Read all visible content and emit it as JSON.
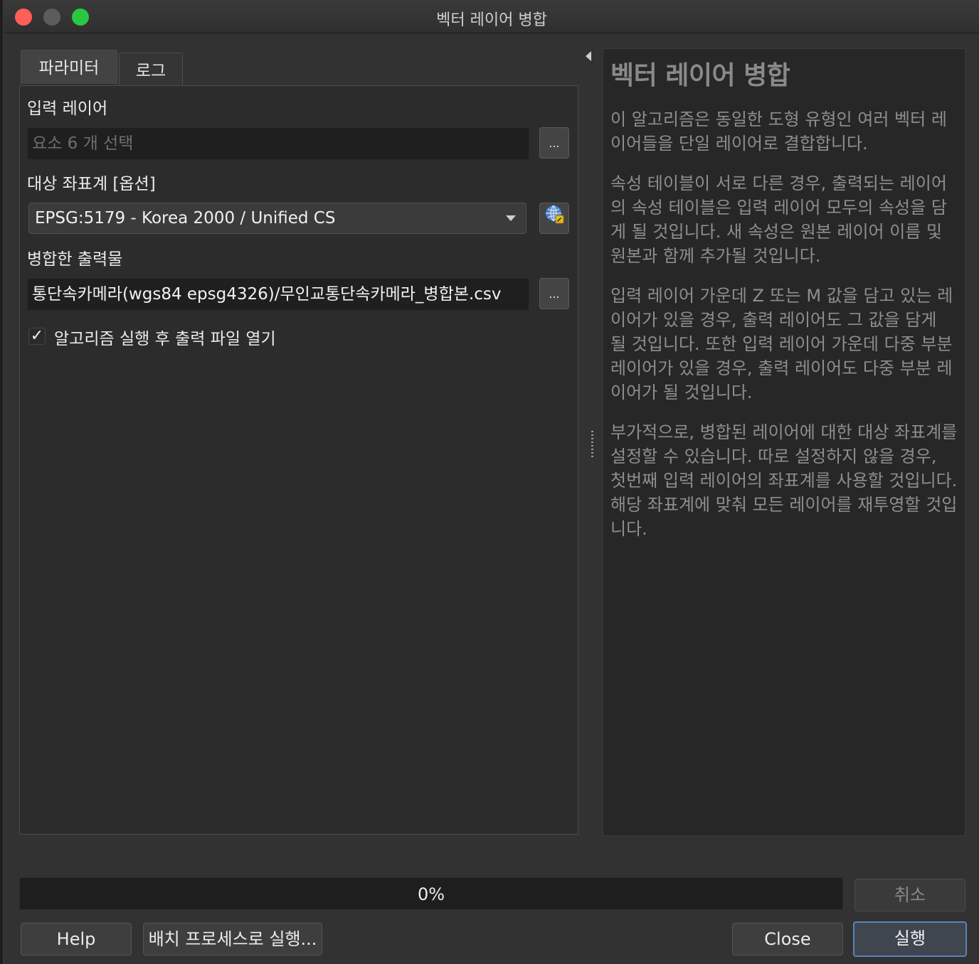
{
  "window": {
    "title": "벡터 레이어 병합"
  },
  "tabs": [
    {
      "label": "파라미터"
    },
    {
      "label": "로그"
    }
  ],
  "params": {
    "input_layer_label": "입력 레이어",
    "input_layer_value": "요소 6 개 선택",
    "browse_label": "...",
    "crs_label": "대상 좌표계 [옵션]",
    "crs_value": "EPSG:5179 - Korea 2000 / Unified CS",
    "output_label": "병합한 출력물",
    "output_value": "통단속카메라(wgs84 epsg4326)/무인교통단속카메라_병합본.csv",
    "open_output_label": "알고리즘 실행 후 출력 파일 열기",
    "open_output_checked": true,
    "checkmark": "✓"
  },
  "help": {
    "title": "벡터 레이어 병합",
    "paragraphs": [
      "이 알고리즘은 동일한 도형 유형인 여러 벡터 레이어들을 단일 레이어로 결합합니다.",
      "속성 테이블이 서로 다른 경우, 출력되는 레이어의 속성 테이블은 입력 레이어 모두의 속성을 담게 될 것입니다. 새 속성은 원본 레이어 이름 및 원본과 함께 추가될 것입니다.",
      "입력 레이어 가운데 Z 또는 M 값을 담고 있는 레이어가 있을 경우, 출력 레이어도 그 값을 담게 될 것입니다. 또한 입력 레이어 가운데 다중 부분 레이어가 있을 경우, 출력 레이어도 다중 부분 레이어가 될 것입니다.",
      "부가적으로, 병합된 레이어에 대한 대상 좌표계를 설정할 수 있습니다. 따로 설정하지 않을 경우, 첫번째 입력 레이어의 좌표계를 사용할 것입니다. 해당 좌표계에 맞춰 모든 레이어를 재투영할 것입니다."
    ]
  },
  "progress": {
    "text": "0%",
    "value": 0
  },
  "buttons": {
    "cancel": "취소",
    "help": "Help",
    "batch": "배치 프로세스로 실행...",
    "close": "Close",
    "run": "실행"
  },
  "icons": {
    "crs_selector": "globe-icon",
    "collapse": "collapse-left-icon"
  },
  "colors": {
    "close_red": "#fe5f57",
    "zoom_green": "#2ac840",
    "run_border": "#5a84b8"
  }
}
